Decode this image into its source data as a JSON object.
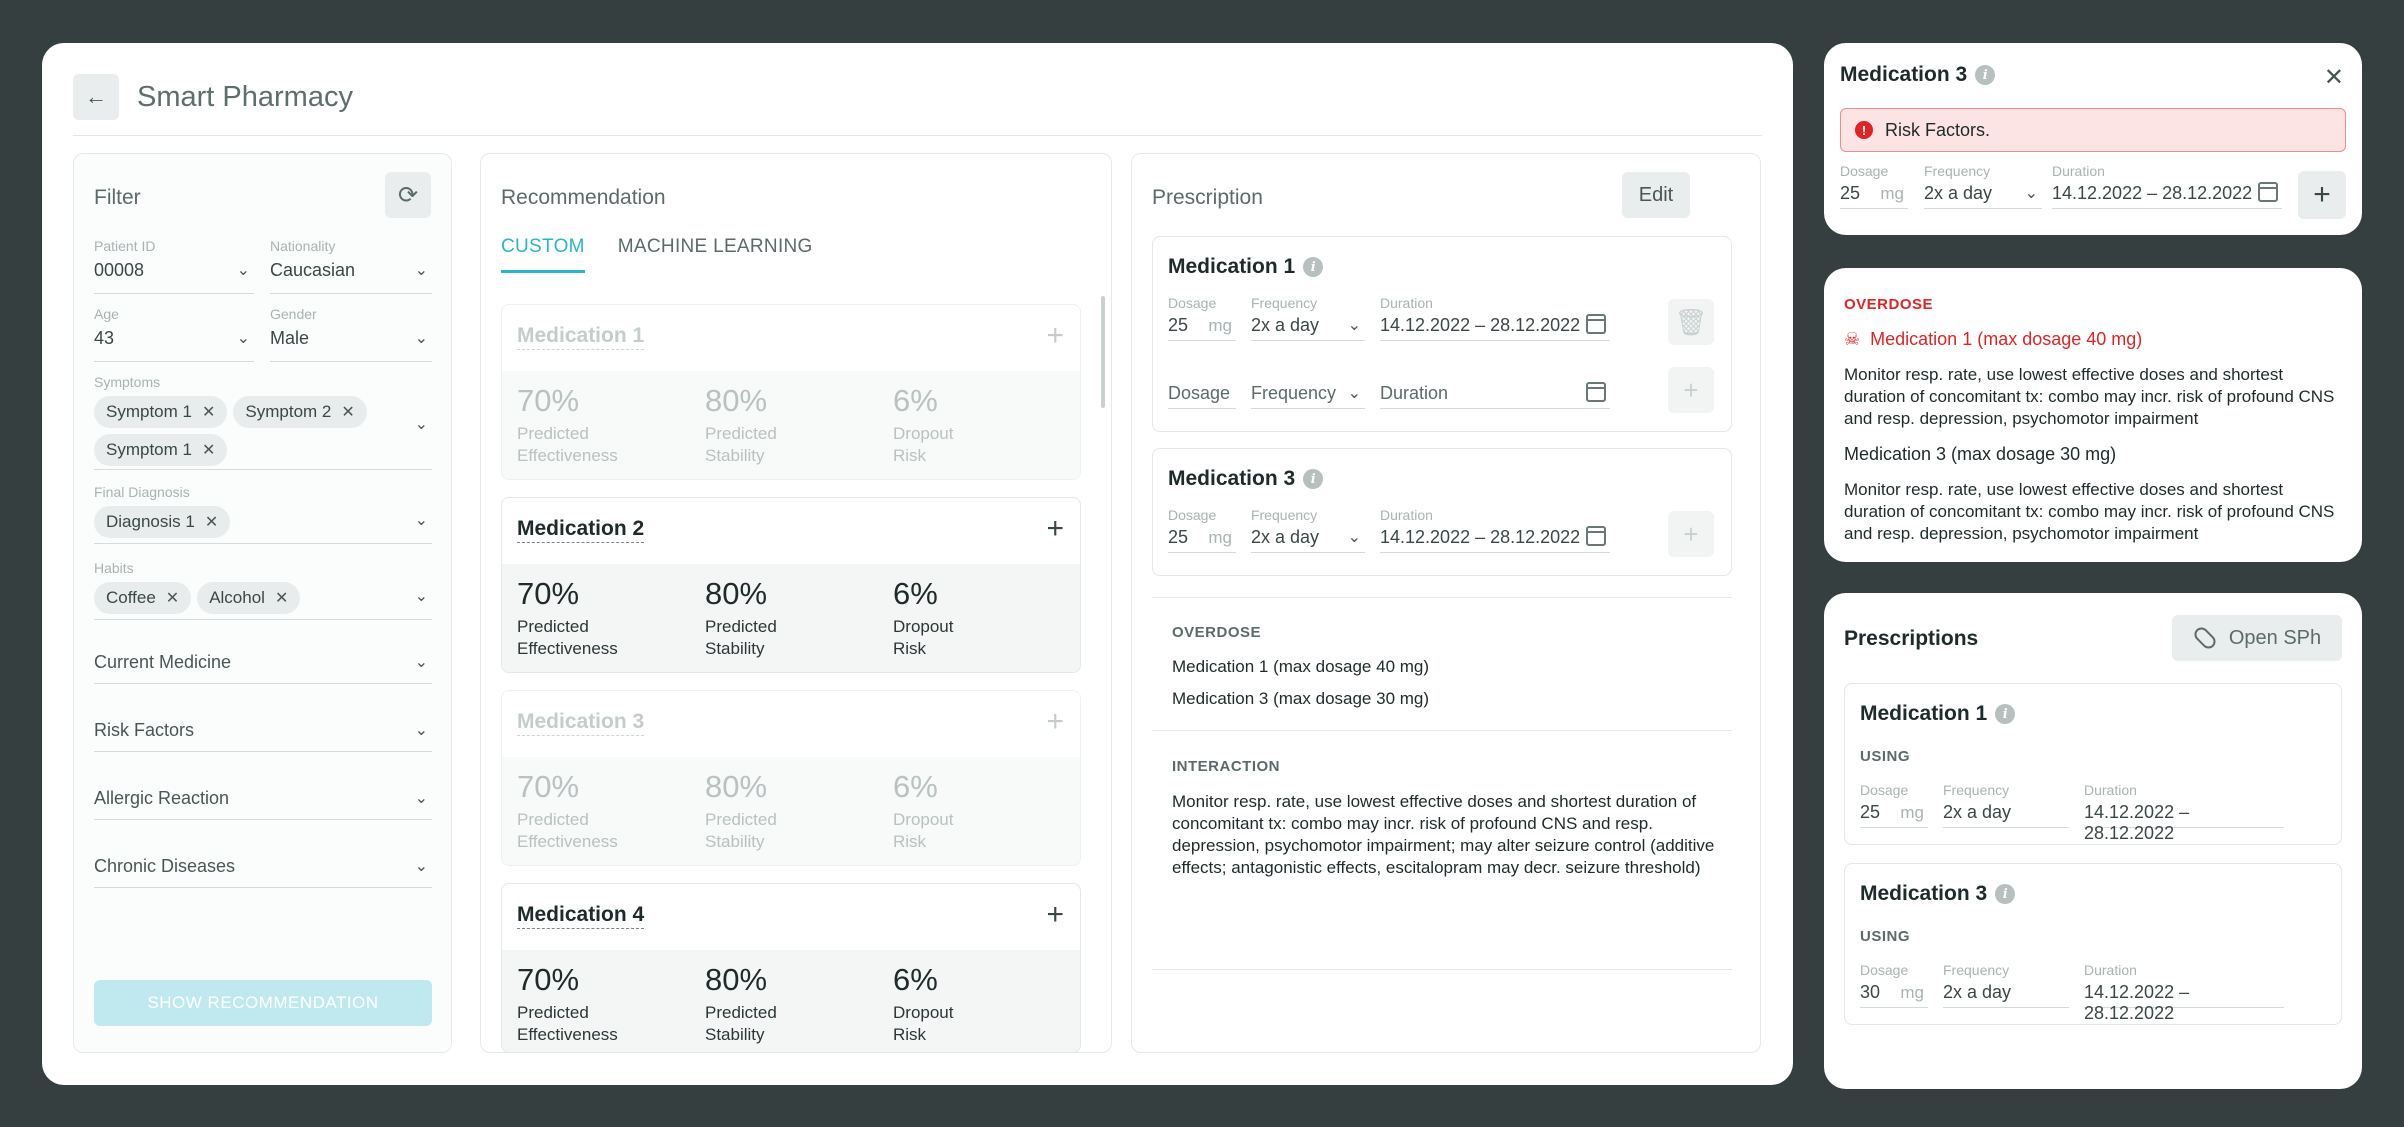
{
  "app": {
    "title": "Smart Pharmacy"
  },
  "filter": {
    "title": "Filter",
    "patient_id": {
      "label": "Patient ID",
      "value": "00008"
    },
    "nationality": {
      "label": "Nationality",
      "value": "Caucasian"
    },
    "age": {
      "label": "Age",
      "value": "43"
    },
    "gender": {
      "label": "Gender",
      "value": "Male"
    },
    "symptoms": {
      "label": "Symptoms",
      "chips": [
        "Symptom 1",
        "Symptom 2",
        "Symptom 1"
      ]
    },
    "final_diagnosis": {
      "label": "Final Diagnosis",
      "chips": [
        "Diagnosis 1"
      ]
    },
    "habits": {
      "label": "Habits",
      "chips": [
        "Coffee",
        "Alcohol"
      ]
    },
    "current_medicine": "Current Medicine",
    "risk_factors": "Risk Factors",
    "allergic_reaction": "Allergic Reaction",
    "chronic_diseases": "Chronic Diseases",
    "show_button": "SHOW RECOMMENDATION"
  },
  "recommendation": {
    "title": "Recommendation",
    "tabs": [
      "CUSTOM",
      "MACHINE LEARNING"
    ],
    "meds": [
      {
        "name": "Medication 1",
        "effectiveness": "70%",
        "stability": "80%",
        "dropout": "6%"
      },
      {
        "name": "Medication 2",
        "effectiveness": "70%",
        "stability": "80%",
        "dropout": "6%"
      },
      {
        "name": "Medication 3",
        "effectiveness": "70%",
        "stability": "80%",
        "dropout": "6%"
      },
      {
        "name": "Medication 4",
        "effectiveness": "70%",
        "stability": "80%",
        "dropout": "6%"
      }
    ],
    "labels": {
      "eff_1": "Predicted",
      "eff_2": "Effectiveness",
      "stab_1": "Predicted",
      "stab_2": "Stability",
      "drop_1": "Dropout",
      "drop_2": "Risk"
    }
  },
  "prescription": {
    "title": "Prescription",
    "edit": "Edit",
    "labels": {
      "dosage": "Dosage",
      "frequency": "Frequency",
      "duration": "Duration",
      "unit": "mg"
    },
    "med1": {
      "name": "Medication 1",
      "dosage": "25",
      "frequency": "2x a day",
      "duration": "14.12.2022 – 28.12.2022"
    },
    "med3": {
      "name": "Medication 3",
      "dosage": "25",
      "frequency": "2x a day",
      "duration": "14.12.2022 – 28.12.2022"
    },
    "overdose": {
      "title": "OVERDOSE",
      "lines": [
        "Medication 1 (max dosage 40 mg)",
        "Medication 3 (max dosage 30 mg)"
      ]
    },
    "interaction": {
      "title": "INTERACTION",
      "text": "Monitor resp. rate, use lowest effective doses and shortest duration of concomitant tx: combo may incr. risk of profound CNS and resp. depression, psychomotor impairment; may alter seizure control (additive effects; antagonistic effects, escitalopram may decr. seizure threshold)"
    }
  },
  "detail": {
    "title": "Medication 3",
    "alert": "Risk Factors.",
    "dosage": "25",
    "frequency": "2x a day",
    "duration": "14.12.2022 – 28.12.2022"
  },
  "overdose_card": {
    "title": "OVERDOSE",
    "med1": "Medication 1 (max dosage 40 mg)",
    "med1_text": "Monitor resp. rate, use lowest effective doses and shortest duration of concomitant tx: combo may incr. risk of profound CNS and resp. depression, psychomotor impairment",
    "med3": "Medication 3 (max dosage 30 mg)",
    "med3_text": "Monitor resp. rate, use lowest effective doses and shortest duration of concomitant tx: combo may incr. risk of profound CNS and resp. depression, psychomotor impairment"
  },
  "prescriptions": {
    "title": "Prescriptions",
    "open_button": "Open SPh",
    "using": "USING",
    "items": [
      {
        "name": "Medication 1",
        "dosage": "25",
        "frequency": "2x a day",
        "duration": "14.12.2022 – 28.12.2022"
      },
      {
        "name": "Medication 3",
        "dosage": "30",
        "frequency": "2x a day",
        "duration": "14.12.2022 – 28.12.2022"
      }
    ]
  },
  "colors": {
    "accent": "#29b6c6",
    "danger": "#e02424",
    "background": "#353f3f"
  }
}
